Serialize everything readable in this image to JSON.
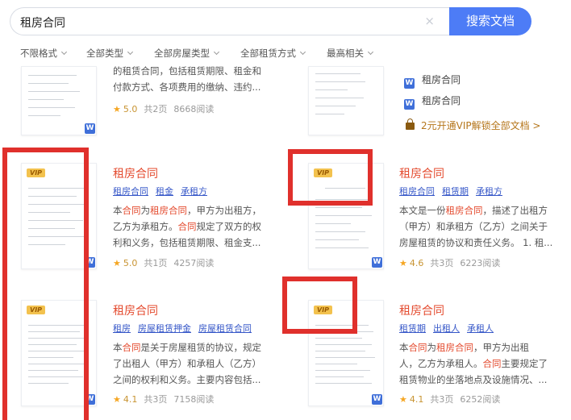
{
  "search": {
    "query": "租房合同",
    "clear_icon": "×",
    "button_label": "搜索文档"
  },
  "filters": [
    "不限格式",
    "全部类型",
    "全部房屋类型",
    "全部租赁方式",
    "最高相关"
  ],
  "top_left": {
    "desc_line1": "的租赁合同，包括租赁期限、租金和",
    "desc_line2": "付款方式、各项费用的缴纳、违约...",
    "rating": "5.0",
    "pages": "共2页",
    "reads": "8668阅读"
  },
  "top_right": {
    "related": [
      "租房合同",
      "租房合同"
    ],
    "vip_link": "2元开通VIP解锁全部文档 >"
  },
  "badges": {
    "vip": "VIP",
    "word": "W"
  },
  "cards": [
    {
      "title": "租房合同",
      "tags": [
        "租房合同",
        "租金",
        "承租方"
      ],
      "desc1_a": "本",
      "desc1_hl1": "合同",
      "desc1_b": "为",
      "desc1_hl2": "租房合同",
      "desc1_c": "，甲方为出租方，",
      "desc2": "乙方为承租方。",
      "desc2_hl": "合同",
      "desc2_b": "规定了双方的权",
      "desc3": "利和义务，包括租赁期限、租金支...",
      "rating": "5.0",
      "pages": "共1页",
      "reads": "4257阅读"
    },
    {
      "title": "租房合同",
      "tags": [
        "租房合同",
        "租赁期",
        "承租方"
      ],
      "desc1": "本文是一份",
      "desc1_hl": "租房合同",
      "desc1_b": "，描述了出租方",
      "desc2": "（甲方）和承租方（乙方）之间关于",
      "desc3": "房屋租赁的协议和责任义务。 1. 租...",
      "rating": "4.6",
      "pages": "共3页",
      "reads": "6223阅读"
    },
    {
      "title": "租房合同",
      "tags": [
        "租房",
        "房屋租赁押金",
        "房屋租赁合同"
      ],
      "desc1_a": "本",
      "desc1_hl": "合同",
      "desc1_b": "是关于房屋租赁的协议，规定",
      "desc2": "了出租人（甲方）和承租人（乙方）",
      "desc3": "之间的权利和义务。主要内容包括...",
      "rating": "4.1",
      "pages": "共3页",
      "reads": "7158阅读"
    },
    {
      "title": "租房合同",
      "tags": [
        "租赁期",
        "出租人",
        "承租人"
      ],
      "desc1_a": "本",
      "desc1_hl1": "合同",
      "desc1_b": "为",
      "desc1_hl2": "租房合同",
      "desc1_c": "，甲方为出租",
      "desc2": "人，乙方为承租人。",
      "desc2_hl": "合同",
      "desc2_b": "主要规定了",
      "desc3": "租赁物业的坐落地点及设施情况、...",
      "rating": "4.1",
      "pages": "共3页",
      "reads": "6252阅读"
    }
  ],
  "colors": {
    "accent": "#4d7cf6",
    "highlight": "#e44b2f",
    "tag": "#3657c8",
    "annotation": "#e0302c"
  }
}
